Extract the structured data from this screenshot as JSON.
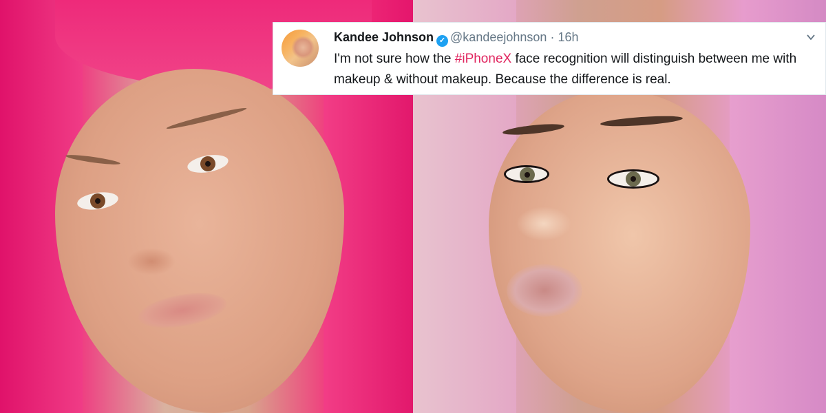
{
  "tweet": {
    "author_name": "Kandee Johnson",
    "author_handle": "@kandeejohnson",
    "separator": "·",
    "time": "16h",
    "verified_glyph": "✓",
    "text_before": "I'm not sure how the ",
    "hashtag": "#iPhoneX",
    "text_after": " face recognition will distinguish between me with makeup & without makeup. Because the difference is real.",
    "avatar_icon": "profile-avatar",
    "menu_icon": "chevron-down-icon"
  },
  "colors": {
    "hashtag": "#e0245e",
    "verified": "#1da1f2",
    "muted_text": "#657786",
    "hair_left": "#ee2a7a",
    "hair_right": "#e3a1cd"
  }
}
